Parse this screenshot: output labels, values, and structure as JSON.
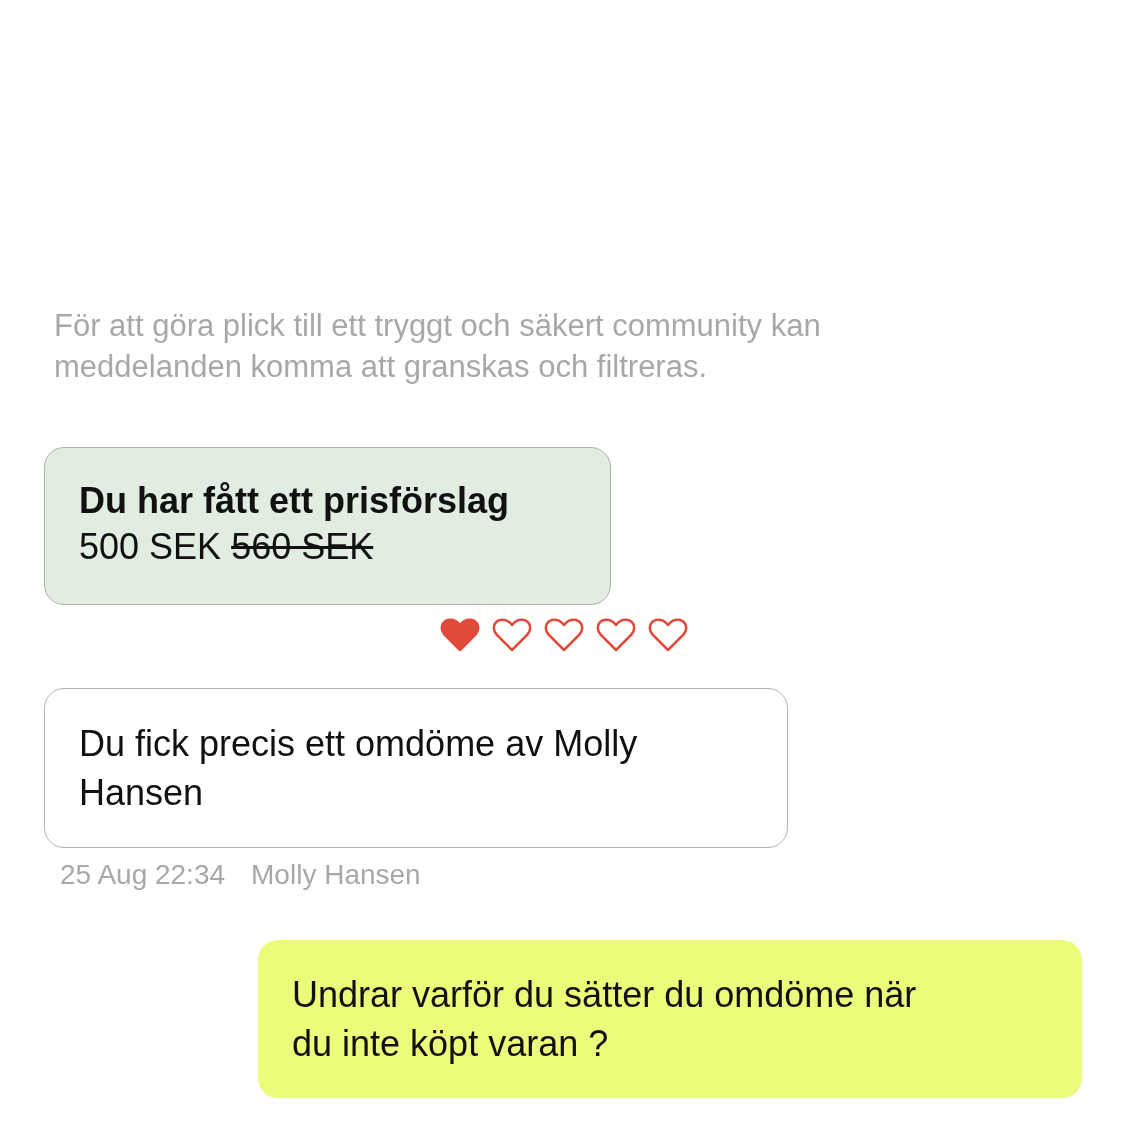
{
  "notice": "För att göra plick till ett tryggt och säkert community kan meddelanden komma att granskas och filtreras.",
  "offer": {
    "title": "Du har fått ett prisförslag",
    "price": "500 SEK",
    "old_price": "560 SEK"
  },
  "rating": {
    "stars": 1
  },
  "messages": [
    {
      "kind": "incoming",
      "text": "Du fick precis ett omdöme av Molly Hansen",
      "time": "25 Aug 22:34",
      "sender": "Molly Hansen"
    },
    {
      "kind": "outgoing",
      "text": "Undrar varför du sätter du omdöme när du inte köpt varan ?"
    }
  ]
}
